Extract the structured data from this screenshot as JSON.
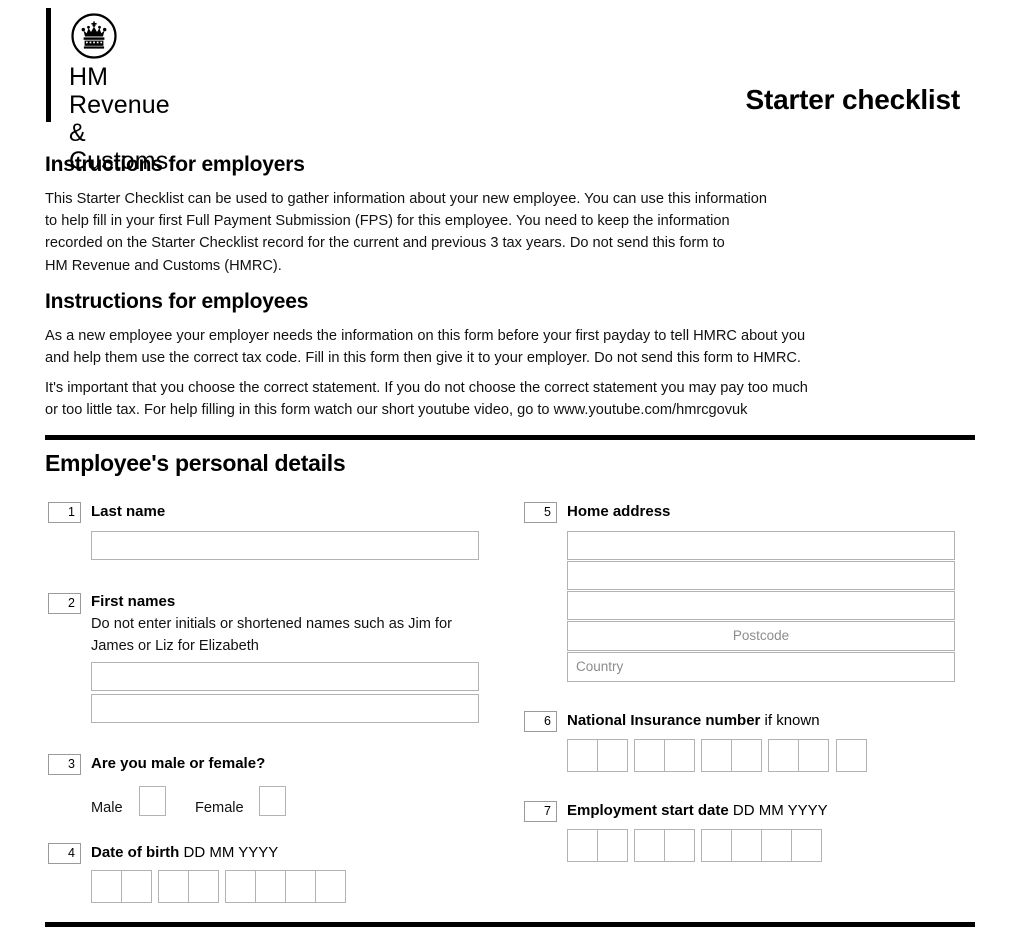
{
  "header": {
    "logo_icon": "royal-crown-icon",
    "logo_text": "HM Revenue\n& Customs",
    "doc_title": "Starter checklist"
  },
  "instructions": {
    "employers": {
      "heading": "Instructions for employers",
      "body": "This Starter Checklist can be used to gather information about your new employee. You can use this information\nto help fill in your first Full Payment Submission (FPS) for this employee. You need to keep the information\nrecorded on the Starter Checklist record for the current and previous 3 tax years. Do not send this form to\nHM Revenue and Customs (HMRC)."
    },
    "employees": {
      "heading": "Instructions for employees",
      "body1": "As a new employee your employer needs the information on this form before your first payday to tell HMRC about you\nand help them use the correct tax code. Fill in this form then give it to your employer. Do not send this form to HMRC.",
      "body2": "It's important that you choose the correct statement. If you do not choose the correct statement you may pay too much\nor too little tax. For help filling in this form watch our short youtube video, go to www.youtube.com/hmrcgovuk"
    }
  },
  "personal_details": {
    "heading": "Employee's personal details",
    "q1": {
      "number": "1",
      "label": "Last name",
      "value": ""
    },
    "q2": {
      "number": "2",
      "label": "First names",
      "hint": "Do not enter initials or shortened names such as Jim for\nJames or Liz for Elizabeth",
      "value_line1": "",
      "value_line2": ""
    },
    "q3": {
      "number": "3",
      "label": "Are you male or female?",
      "male_label": "Male",
      "female_label": "Female",
      "male_checked": "",
      "female_checked": ""
    },
    "q4": {
      "number": "4",
      "label": "Date of birth",
      "format": "DD MM YYYY",
      "groups": [
        2,
        2,
        4
      ],
      "values": [
        "",
        "",
        "",
        "",
        "",
        "",
        "",
        ""
      ]
    },
    "q5": {
      "number": "5",
      "label": "Home address",
      "line1": "",
      "line2": "",
      "line3": "",
      "postcode_placeholder": "Postcode",
      "postcode_value": "",
      "country_placeholder": "Country",
      "country_value": ""
    },
    "q6": {
      "number": "6",
      "label_bold": "National Insurance number",
      "label_light": "if known",
      "groups": [
        2,
        2,
        2,
        2,
        1
      ],
      "values": [
        "",
        "",
        "",
        "",
        "",
        "",
        "",
        "",
        ""
      ]
    },
    "q7": {
      "number": "7",
      "label": "Employment start date",
      "format": "DD MM YYYY",
      "groups": [
        2,
        2,
        4
      ],
      "values": [
        "",
        "",
        "",
        "",
        "",
        "",
        "",
        ""
      ]
    }
  },
  "colors": {
    "rule": "#000000",
    "field_border": "#b3b3b3",
    "placeholder": "#8d8d8d",
    "num_border": "#9a9a9a"
  }
}
